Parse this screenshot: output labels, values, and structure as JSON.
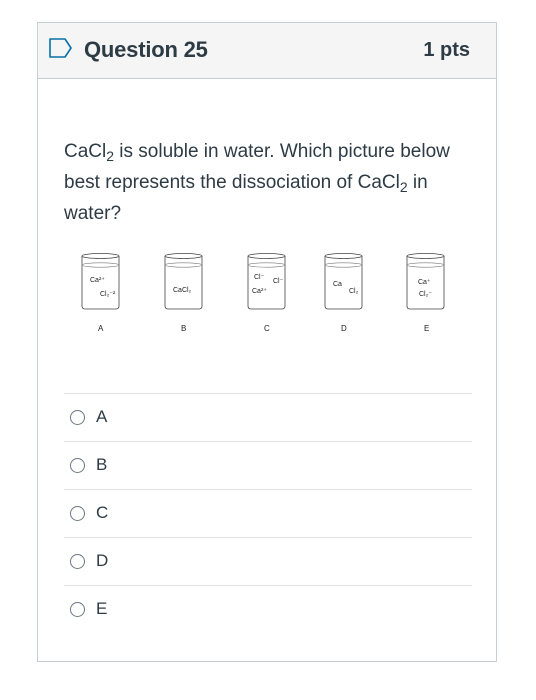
{
  "question": {
    "title": "Question 25",
    "points": "1 pts",
    "text_parts": [
      "CaCl",
      "2",
      " is soluble in water. Which picture below best represents the dissociation of ",
      "CaCl",
      "2",
      " in water?"
    ]
  },
  "diagram": {
    "beakers": [
      {
        "letter": "A",
        "labels": [
          "Ca²⁺",
          "Cl₂⁻²"
        ]
      },
      {
        "letter": "B",
        "labels": [
          "CaCl₂"
        ]
      },
      {
        "letter": "C",
        "labels": [
          "Cl⁻",
          "Cl⁻",
          "Ca²⁺"
        ]
      },
      {
        "letter": "D",
        "labels": [
          "Ca",
          "Cl₂"
        ]
      },
      {
        "letter": "E",
        "labels": [
          "Ca⁺",
          "Cl₂⁻"
        ]
      }
    ]
  },
  "answers": [
    {
      "label": "A"
    },
    {
      "label": "B"
    },
    {
      "label": "C"
    },
    {
      "label": "D"
    },
    {
      "label": "E"
    }
  ],
  "colors": {
    "header_bg": "#f5f5f5",
    "border": "#c7cdd1",
    "text": "#2d3b45",
    "flag": "#0770a3"
  },
  "icons": {
    "flag": "flag-outline-icon",
    "radio": "radio-empty-icon"
  }
}
